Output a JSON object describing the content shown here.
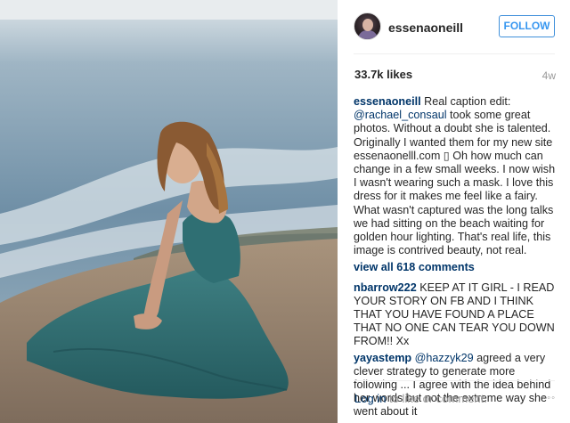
{
  "post": {
    "username": "essenaoneill",
    "follow_label": "FOLLOW",
    "likes": "33.7k likes",
    "age": "4w"
  },
  "caption": {
    "author": "essenaoneill",
    "lead": "Real caption edit:",
    "mention": "@rachael_consaul",
    "text": "took some great photos. Without a doubt she is talented. Originally I wanted them for my new site essenaonelll.com ▯ Oh how much can change in a few small weeks. I now wish I wasn't wearing such a mask. I love this dress for it makes me feel like a fairy. What wasn't captured was the long talks we had sitting on the beach waiting for golden hour lighting. That's real life, this image is contrived beauty, not real."
  },
  "view_all": "view all 618 comments",
  "comments": [
    {
      "author": "nbarrow222",
      "mention": "",
      "text": "KEEP AT IT GIRL - I READ YOUR STORY ON FB AND I THINK THAT YOU HAVE FOUND A PLACE THAT NO ONE CAN TEAR YOU DOWN FROM!! Xx"
    },
    {
      "author": "yayastemp",
      "mention": "@hazzyk29",
      "text": "agreed a very clever strategy to generate more following ... I agree with the idea behind her words but not the extreme way she went about it"
    }
  ],
  "footer": {
    "login_link": "Log in",
    "login_rest": "to like or comment.",
    "more_icon": "more-dots-icon",
    "more_glyph": "◦◦◦"
  },
  "colors": {
    "link": "#003569",
    "follow_blue": "#3897f0",
    "muted": "#999999",
    "dress": "#2f6f73"
  }
}
